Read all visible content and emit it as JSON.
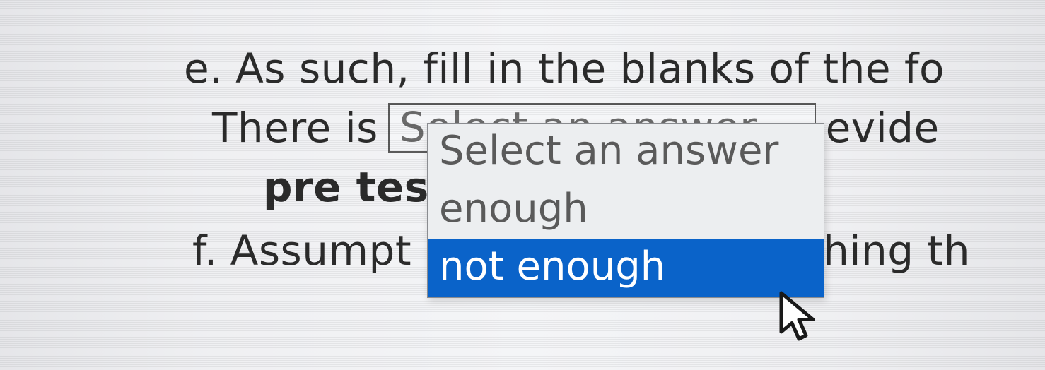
{
  "question_e": {
    "label": "e.",
    "text_1": "As such, fill in the blanks of the fo",
    "line2_prefix": "There is",
    "select_placeholder": "Select an answer",
    "line2_suffix": "evide",
    "bold_label": "pre test",
    "options": {
      "placeholder": "Select an answer",
      "opt1": "enough",
      "opt2": "not enough"
    }
  },
  "question_f": {
    "label": "f.",
    "text_before": "Assumpt",
    "text_after": "hing th"
  }
}
